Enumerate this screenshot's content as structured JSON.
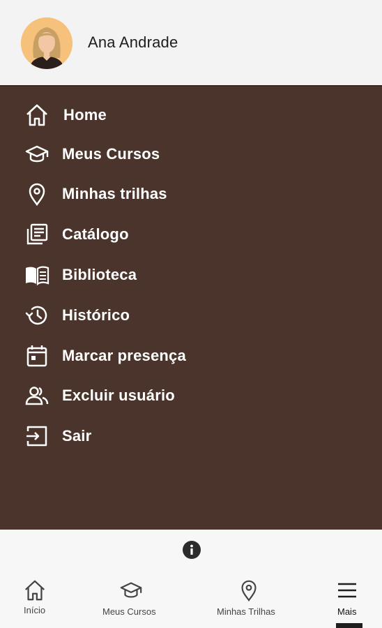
{
  "user": {
    "name": "Ana Andrade",
    "avatar_colors": {
      "background": "#f6c17a",
      "hair": "#c9a063",
      "skin": "#f2c7a4",
      "shirt": "#2a1f1b"
    }
  },
  "menu": {
    "background": "#4b342b",
    "items": [
      {
        "label": "Home",
        "icon": "home-icon"
      },
      {
        "label": "Meus Cursos",
        "icon": "graduation-cap-icon"
      },
      {
        "label": "Minhas trilhas",
        "icon": "location-pin-icon"
      },
      {
        "label": "Catálogo",
        "icon": "catalog-icon"
      },
      {
        "label": "Biblioteca",
        "icon": "book-icon"
      },
      {
        "label": "Histórico",
        "icon": "history-icon"
      },
      {
        "label": "Marcar presença",
        "icon": "calendar-icon"
      },
      {
        "label": "Excluir usuário",
        "icon": "users-icon"
      },
      {
        "label": "Sair",
        "icon": "logout-icon"
      }
    ]
  },
  "info": {
    "icon": "info-icon"
  },
  "bottom_nav": {
    "items": [
      {
        "label": "Início",
        "icon": "home-icon"
      },
      {
        "label": "Meus Cursos",
        "icon": "graduation-cap-icon"
      },
      {
        "label": "Minhas Trilhas",
        "icon": "location-pin-icon"
      },
      {
        "label": "Mais",
        "icon": "hamburger-menu-icon",
        "active": true
      }
    ]
  }
}
